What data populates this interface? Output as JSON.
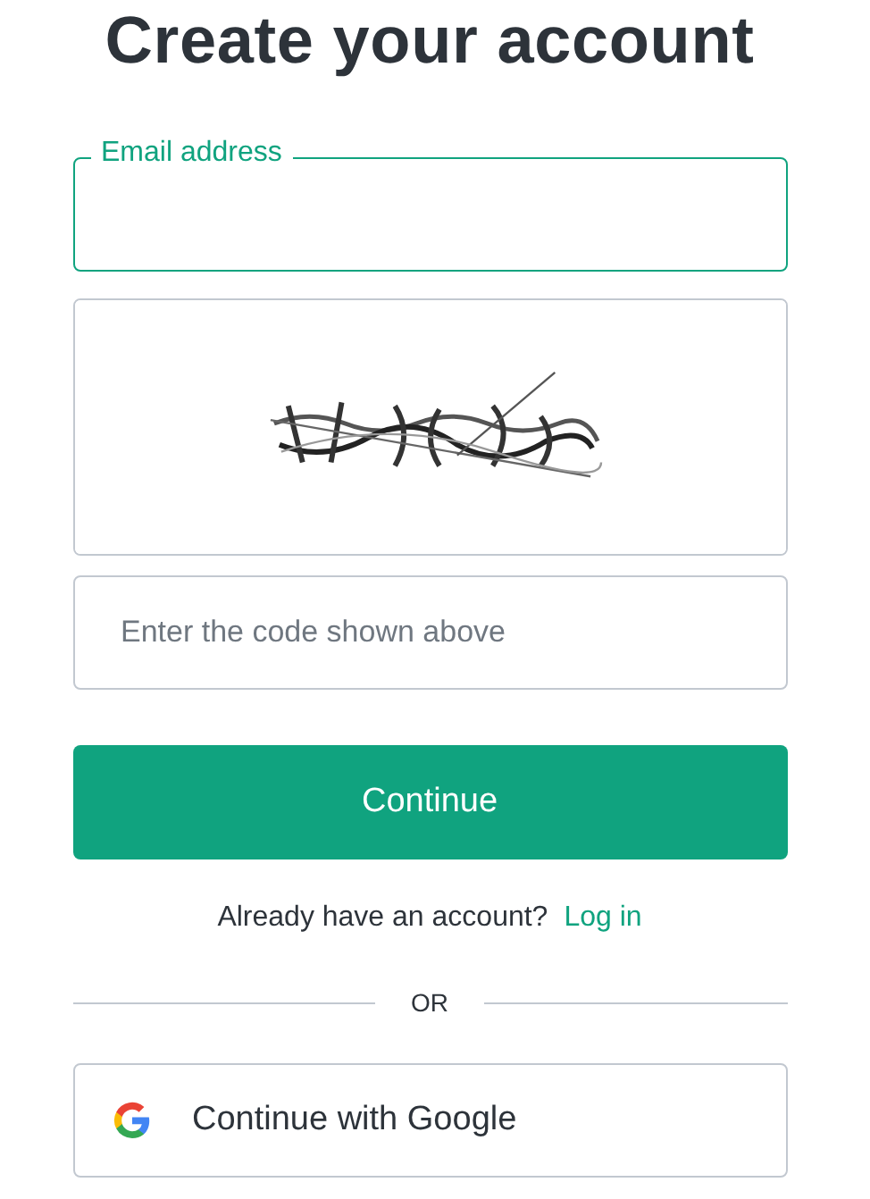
{
  "title": "Create your account",
  "email_field": {
    "label": "Email address"
  },
  "code_field": {
    "placeholder": "Enter the code shown above"
  },
  "continue_button": {
    "label": "Continue"
  },
  "login_prompt": {
    "text": "Already have an account?",
    "link": "Log in"
  },
  "divider": {
    "label": "OR"
  },
  "google_button": {
    "label": "Continue with Google"
  }
}
